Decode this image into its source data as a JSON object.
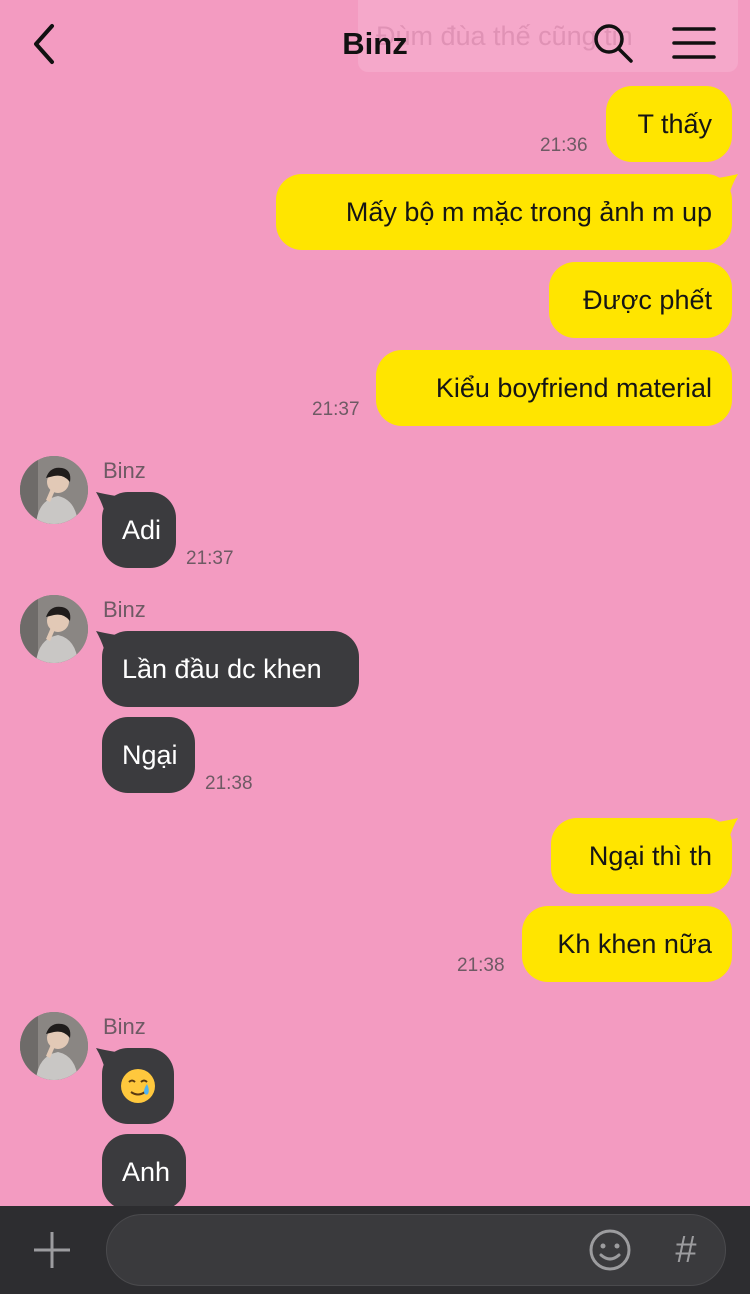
{
  "header": {
    "title": "Binz",
    "ghost_text": "Đùm đùa thế cũng tin"
  },
  "messages": [
    {
      "from": "me",
      "text": "T thấy",
      "time": "21:36"
    },
    {
      "from": "me",
      "text": "Mấy bộ m mặc trong ảnh m up"
    },
    {
      "from": "me",
      "text": "Được phết"
    },
    {
      "from": "me",
      "text": "Kiểu boyfriend material",
      "time": "21:37"
    },
    {
      "from": "them",
      "sender": "Binz",
      "text": "Adi",
      "time": "21:37"
    },
    {
      "from": "them",
      "sender": "Binz",
      "text": "Lần đầu dc khen"
    },
    {
      "from": "them",
      "text": "Ngại",
      "time": "21:38"
    },
    {
      "from": "me",
      "text": "Ngại thì th"
    },
    {
      "from": "me",
      "text": "Kh khen nữa",
      "time": "21:38"
    },
    {
      "from": "them",
      "sender": "Binz",
      "text": "🥲",
      "emoji_name": "crying-smile-emoji"
    },
    {
      "from": "them",
      "text": "Anh"
    }
  ],
  "input": {
    "placeholder": ""
  },
  "icons": {
    "back": "chevron-left-icon",
    "search": "search-icon",
    "menu": "hamburger-menu-icon",
    "plus": "plus-icon",
    "emoji": "smiley-icon",
    "hashtag": "#"
  },
  "colors": {
    "background": "#f39bc1",
    "my_bubble": "#ffe500",
    "their_bubble": "#3b3b3e",
    "input_bar": "#2d2d30"
  }
}
